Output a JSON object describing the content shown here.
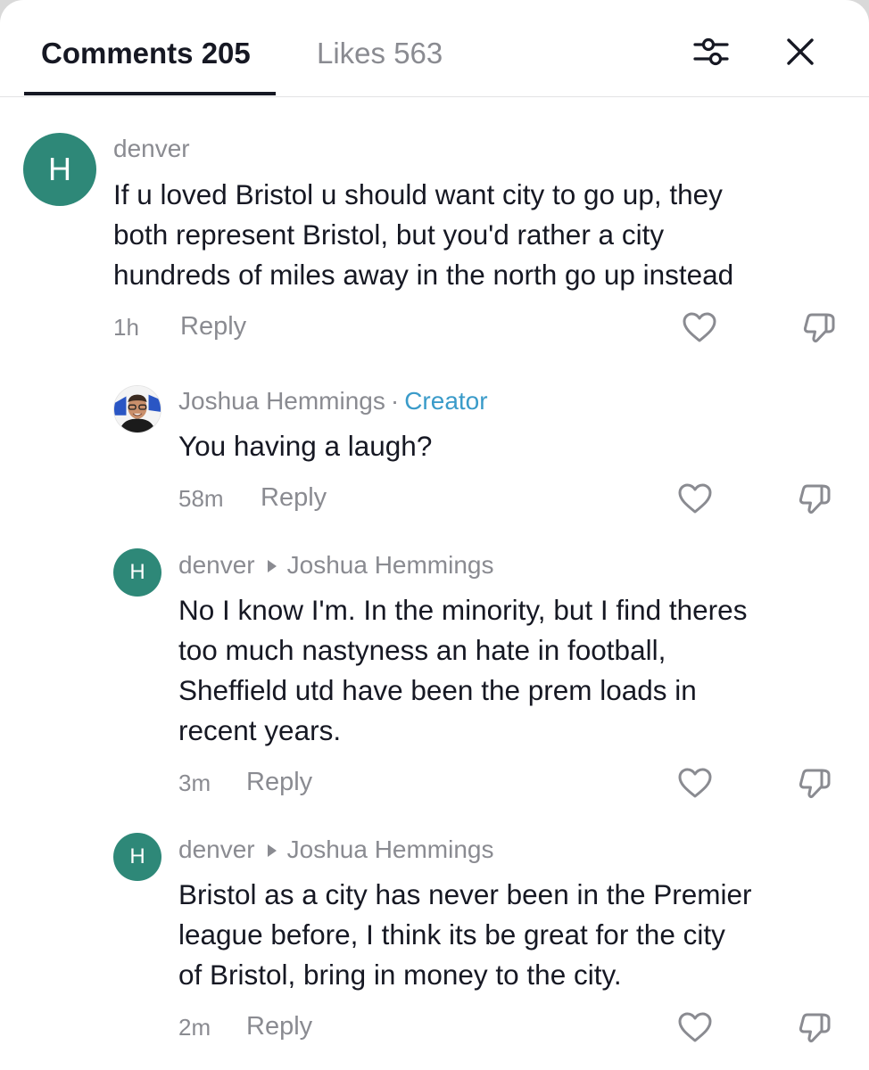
{
  "header": {
    "tabs": [
      {
        "label": "Comments 205",
        "active": true
      },
      {
        "label": "Likes 563",
        "active": false
      }
    ],
    "filter_icon": "sliders-icon",
    "close_icon": "close-icon"
  },
  "comments": [
    {
      "avatar_initial": "H",
      "username": "denver",
      "lines": [
        "If u loved Bristol u should want city to go up, they",
        "both represent Bristol, but you'd rather a city",
        "hundreds of miles away in the north go up instead"
      ],
      "time": "1h",
      "reply_label": "Reply"
    },
    {
      "username": "Joshua Hemmings",
      "separator": "·",
      "badge": "Creator",
      "lines": [
        "You having a laugh?"
      ],
      "time": "58m",
      "reply_label": "Reply"
    },
    {
      "avatar_initial": "H",
      "username": "denver",
      "reply_to": "Joshua Hemmings",
      "lines": [
        "No I know I'm. In the minority, but I find theres",
        "too much nastyness an hate in football,",
        "Sheffield utd have been the prem loads in",
        "recent years."
      ],
      "time": "3m",
      "reply_label": "Reply"
    },
    {
      "avatar_initial": "H",
      "username": "denver",
      "reply_to": "Joshua Hemmings",
      "lines": [
        "Bristol as a city has never been in the Premier",
        "league before, I think its be great for the city",
        "of Bristol, bring in money to the city."
      ],
      "time": "2m",
      "reply_label": "Reply"
    }
  ],
  "colors": {
    "avatar": "#2e8878",
    "creator_badge": "#3a9bc9",
    "muted_text": "#8a8b91",
    "primary_text": "#161823"
  },
  "icons": {
    "like": "heart-outline-icon",
    "dislike": "thumbs-down-outline-icon"
  }
}
